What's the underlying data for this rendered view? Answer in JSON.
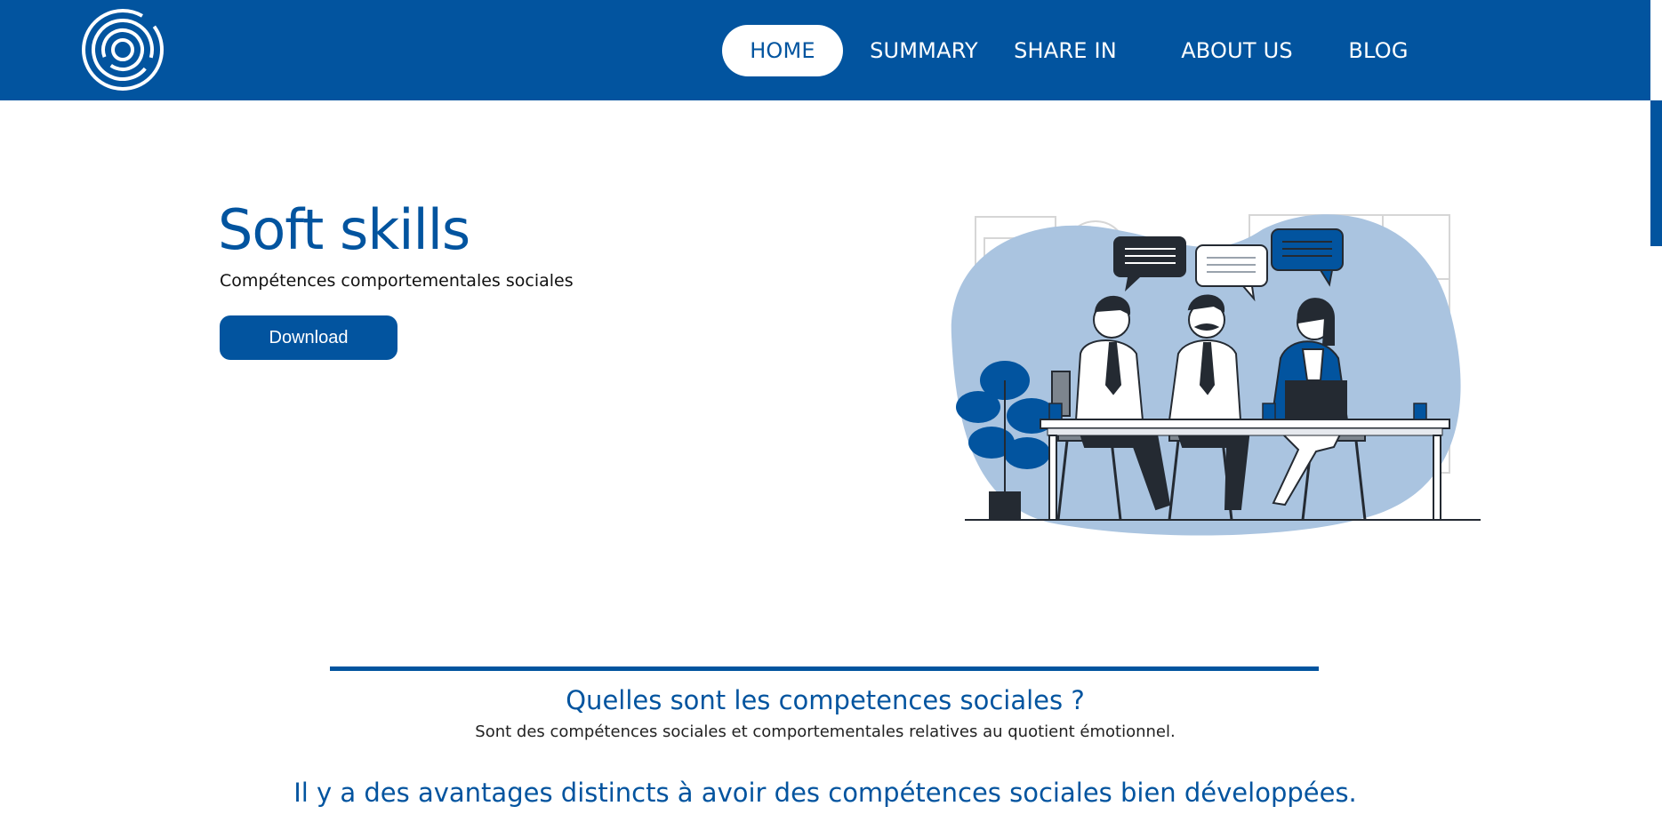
{
  "nav": {
    "items": [
      {
        "label": "HOME",
        "active": true
      },
      {
        "label": "SUMMARY",
        "active": false
      },
      {
        "label": "SHARE IN",
        "active": false
      },
      {
        "label": "ABOUT US",
        "active": false
      },
      {
        "label": "BLOG",
        "active": false
      }
    ]
  },
  "hero": {
    "title": "Soft skills",
    "subtitle": "Compétences comportementales sociales",
    "download_label": "Download"
  },
  "section": {
    "question_title": "Quelles sont les competences sociales ?",
    "question_text": "Sont des compétences sociales et comportementales relatives au quotient émotionnel.",
    "advantages_title": "Il y a des avantages distincts à avoir des compétences sociales bien développées."
  },
  "colors": {
    "brand": "#02549f",
    "blob": "#aac4e0",
    "dark": "#242a32"
  },
  "icons": {
    "logo": "concentric-circles-logo"
  }
}
